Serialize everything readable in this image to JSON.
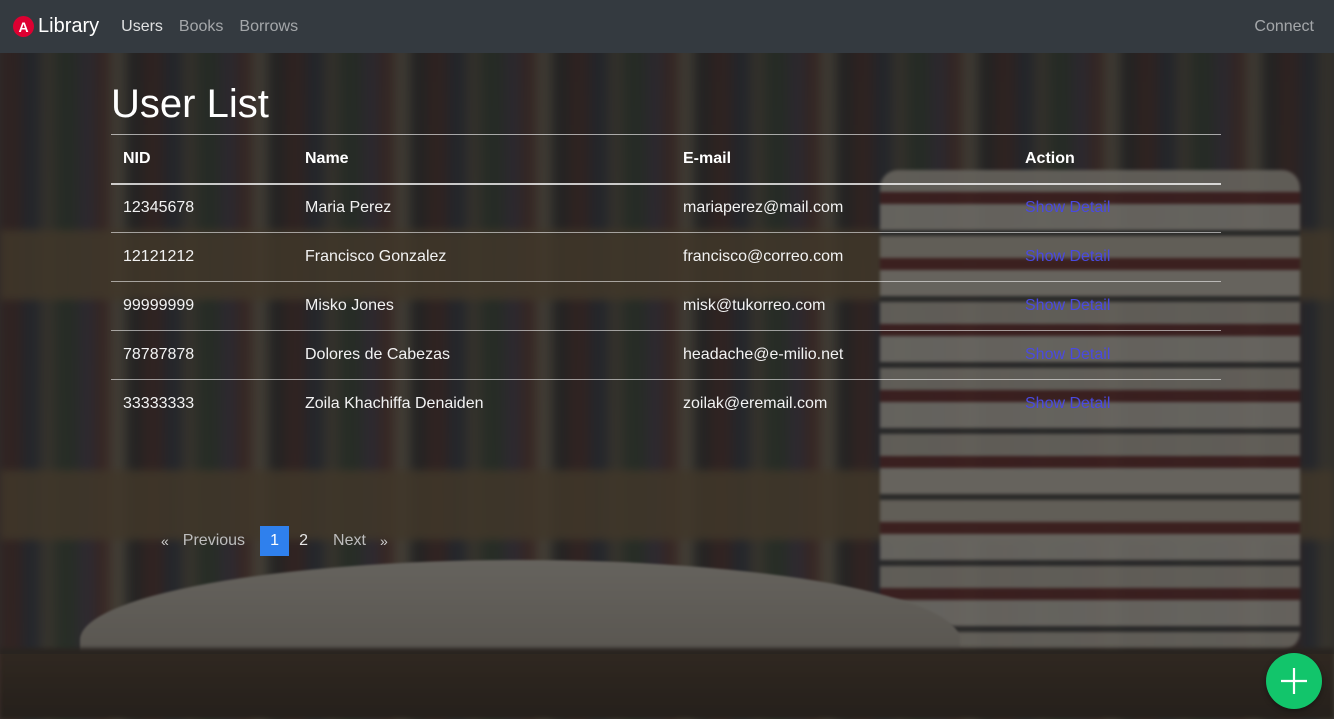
{
  "navbar": {
    "brand_logo": "A",
    "brand": "Library",
    "links": [
      {
        "label": "Users"
      },
      {
        "label": "Books"
      },
      {
        "label": "Borrows"
      }
    ],
    "connect": "Connect"
  },
  "page": {
    "title": "User List"
  },
  "table": {
    "headers": [
      "NID",
      "Name",
      "E-mail",
      "Action"
    ],
    "rows": [
      {
        "nid": "12345678",
        "name": "Maria Perez",
        "email": "mariaperez@mail.com",
        "action": "Show Detail"
      },
      {
        "nid": "12121212",
        "name": "Francisco Gonzalez",
        "email": "francisco@correo.com",
        "action": "Show Detail"
      },
      {
        "nid": "99999999",
        "name": "Misko Jones",
        "email": "misk@tukorreo.com",
        "action": "Show Detail"
      },
      {
        "nid": "78787878",
        "name": "Dolores de Cabezas",
        "email": "headache@e-milio.net",
        "action": "Show Detail"
      },
      {
        "nid": "33333333",
        "name": "Zoila Khachiffa Denaiden",
        "email": "zoilak@eremail.com",
        "action": "Show Detail"
      }
    ]
  },
  "pagination": {
    "prev_arrow": "«",
    "previous": "Previous",
    "pages": [
      "1",
      "2"
    ],
    "current": "1",
    "next": "Next",
    "next_arrow": "»"
  },
  "fab": {
    "icon": "plus-icon"
  },
  "colors": {
    "navbar": "#343a40",
    "accent_link": "#4a4ae0",
    "active_page": "#2f80ed",
    "fab": "#12c56b",
    "brand_logo": "#dd0031"
  }
}
